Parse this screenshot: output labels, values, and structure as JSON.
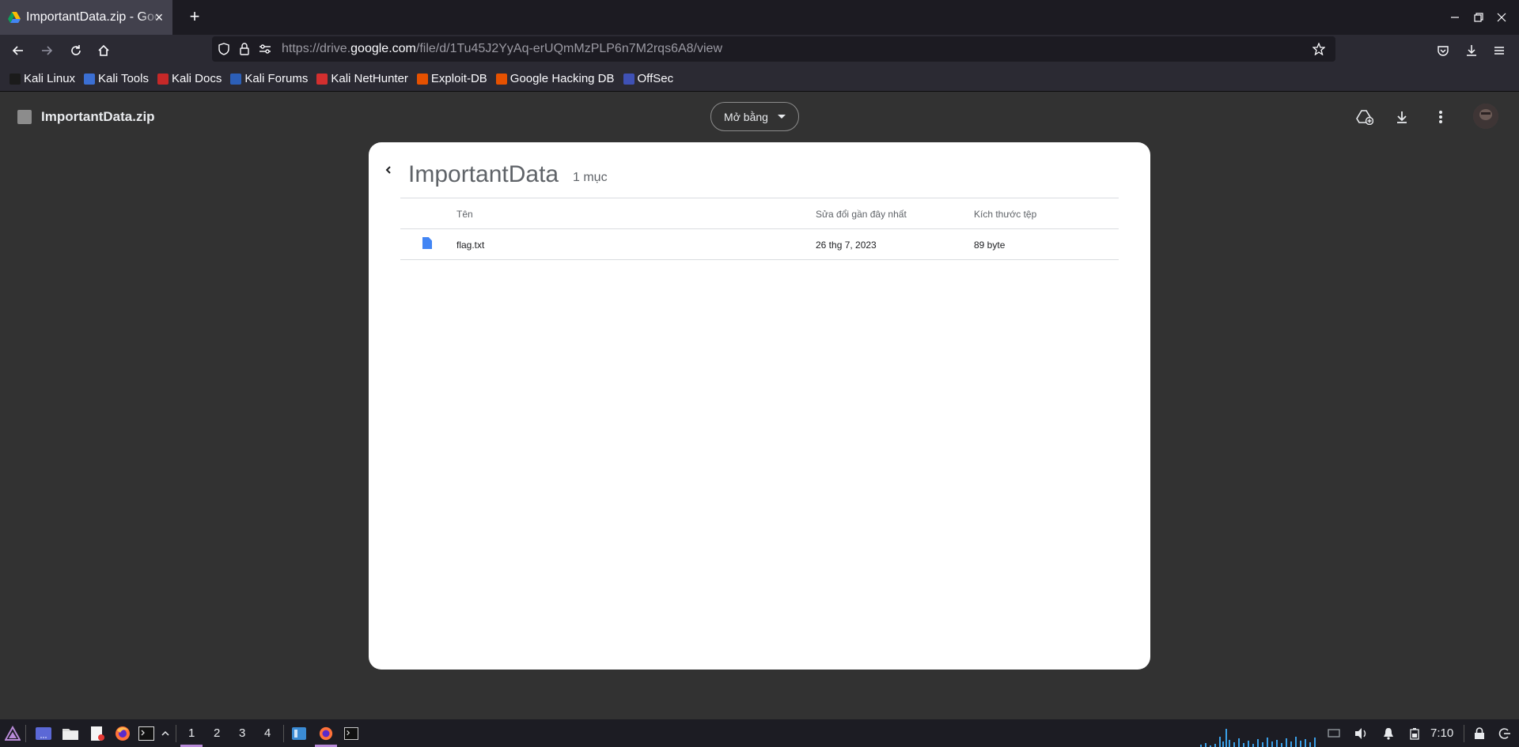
{
  "browser": {
    "tab_title": "ImportantData.zip - Google Drive",
    "url_prefix": "https://drive.",
    "url_domain": "google.com",
    "url_path": "/file/d/1Tu45J2YyAq-erUQmMzPLP6n7M2rqs6A8/view"
  },
  "bookmarks": [
    {
      "label": "Kali Linux",
      "color": "#1b1b1b"
    },
    {
      "label": "Kali Tools",
      "color": "#3b6fd4"
    },
    {
      "label": "Kali Docs",
      "color": "#c62828"
    },
    {
      "label": "Kali Forums",
      "color": "#2c5fb8"
    },
    {
      "label": "Kali NetHunter",
      "color": "#d32f2f"
    },
    {
      "label": "Exploit-DB",
      "color": "#e65100"
    },
    {
      "label": "Google Hacking DB",
      "color": "#e65100"
    },
    {
      "label": "OffSec",
      "color": "#3f51b5"
    }
  ],
  "viewer": {
    "file_title": "ImportantData.zip",
    "open_with_label": "Mở bằng",
    "folder_name": "ImportantData",
    "item_count": "1 mục",
    "columns": {
      "name": "Tên",
      "modified": "Sửa đổi gần đây nhất",
      "size": "Kích thước tệp"
    },
    "rows": [
      {
        "name": "flag.txt",
        "modified": "26 thg 7, 2023",
        "size": "89 byte"
      }
    ]
  },
  "taskbar": {
    "workspaces": [
      "1",
      "2",
      "3",
      "4"
    ],
    "clock": "7:10"
  }
}
